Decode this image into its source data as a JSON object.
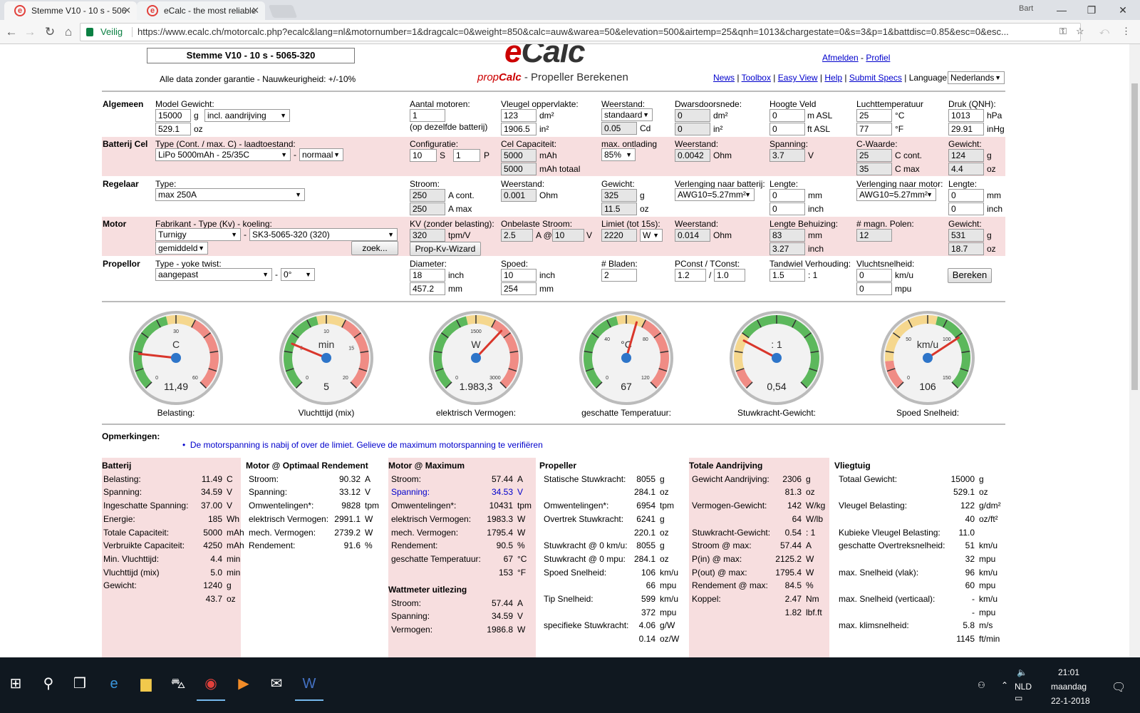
{
  "browser": {
    "tabs": [
      {
        "title": "Stemme V10 - 10 s - 506"
      },
      {
        "title": "eCalc - the most reliable"
      }
    ],
    "user": "Bart",
    "secure_label": "Veilig",
    "url": "https://www.ecalc.ch/motorcalc.php?ecalc&lang=nl&motornumber=1&dragcalc=0&weight=850&calc=auw&warea=50&elevation=500&airtemp=25&qnh=1013&chargestate=0&s=3&p=1&battdisc=0.85&esc=0&esc..."
  },
  "header": {
    "model_title": "Stemme V10 - 10 s - 5065-320",
    "disclaimer": "Alle data zonder garantie - Nauwkeurigheid: +/-10%",
    "logo_e": "e",
    "logo_calc": "Calc",
    "subtitle_prop": "prop",
    "subtitle_calc": "Calc",
    "subtitle_rest": " - Propeller Berekenen",
    "logout": "Afmelden",
    "dash": " - ",
    "profile": "Profiel",
    "nav": [
      "News",
      "Toolbox",
      "Easy View",
      "Help",
      "Submit Specs"
    ],
    "language_label": "Language:",
    "language": "Nederlands"
  },
  "algemeen": {
    "label": "Algemeen",
    "model_weight_label": "Model Gewicht:",
    "weight_g": "15000",
    "unit_g": "g",
    "drive": "incl. aandrijving",
    "weight_oz": "529.1",
    "unit_oz": "oz",
    "motors_label": "Aantal motoren:",
    "motors": "1",
    "motors_note": "(op dezelfde batterij)",
    "wing_label": "Vleugel oppervlakte:",
    "wing_dm": "123",
    "unit_dm": "dm²",
    "wing_in": "1906.5",
    "unit_in": "in²",
    "drag_label": "Weerstand:",
    "drag": "standaard",
    "cd": "0.05",
    "unit_cd": "Cd",
    "cross_label": "Dwarsdoorsnede:",
    "cross_dm": "0",
    "cross_in": "0",
    "field_label": "Hoogte Veld",
    "field_m": "0",
    "unit_masl": "m ASL",
    "field_ft": "0",
    "unit_ftasl": "ft ASL",
    "temp_label": "Luchttemperatuur",
    "temp_c": "25",
    "unit_c": "°C",
    "temp_f": "77",
    "unit_f": "°F",
    "qnh_label": "Druk (QNH):",
    "qnh_hpa": "1013",
    "unit_hpa": "hPa",
    "qnh_inhg": "29.91",
    "unit_inhg": "inHg"
  },
  "batterij": {
    "label": "Batterij Cel",
    "type_label": "Type (Cont. / max. C) - laadtoestand:",
    "type": "LiPo 5000mAh - 25/35C",
    "state": "normaal",
    "config_label": "Configuratie:",
    "s": "10",
    "unit_s": "S",
    "p": "1",
    "unit_p": "P",
    "cap_label": "Cel Capaciteit:",
    "cap": "5000",
    "unit_mah": "mAh",
    "cap_total": "5000",
    "unit_mah_total": "mAh totaal",
    "disch_label": "max. ontlading",
    "disch": "85%",
    "res_label": "Weerstand:",
    "res": "0.0042",
    "unit_ohm": "Ohm",
    "volt_label": "Spanning:",
    "volt": "3.7",
    "unit_v": "V",
    "c_label": "C-Waarde:",
    "c_cont": "25",
    "unit_ccont": "C cont.",
    "c_max": "35",
    "unit_cmax": "C max",
    "w_label": "Gewicht:",
    "w_g": "124",
    "w_oz": "4.4"
  },
  "regelaar": {
    "label": "Regelaar",
    "type_label": "Type:",
    "type": "max 250A",
    "cur_label": "Stroom:",
    "cur_cont": "250",
    "unit_acont": "A cont.",
    "cur_max": "250",
    "unit_amax": "A max",
    "res_label": "Weerstand:",
    "res": "0.001",
    "unit_ohm": "Ohm",
    "w_label": "Gewicht:",
    "w_g": "325",
    "w_oz": "11.5",
    "ext_bat_label": "Verlenging naar batterij:",
    "ext_bat": "AWG10=5.27mm²",
    "len_label": "Lengte:",
    "len_mm": "0",
    "unit_mm": "mm",
    "len_in": "0",
    "unit_inch": "inch",
    "ext_mot_label": "Verlenging naar motor:",
    "ext_mot": "AWG10=5.27mm²",
    "len2_mm": "0",
    "len2_in": "0"
  },
  "motor": {
    "label": "Motor",
    "type_label": "Fabrikant - Type (Kv) - koeling:",
    "maker": "Turnigy",
    "type": "SK3-5065-320 (320)",
    "cooling": "gemiddeld",
    "search": "zoek...",
    "kv_label": "KV (zonder belasting):",
    "kv": "320",
    "unit_kv": "tpm/V",
    "wizard": "Prop-Kv-Wizard",
    "idle_label": "Onbelaste Stroom:",
    "idle_a": "2.5",
    "at": "A @",
    "idle_v": "10",
    "unit_v": "V",
    "limit_label": "Limiet (tot 15s):",
    "limit": "2220",
    "limit_unit": "W",
    "res_label": "Weerstand:",
    "res": "0.014",
    "unit_ohm": "Ohm",
    "case_label": "Lengte Behuizing:",
    "case_mm": "83",
    "case_in": "3.27",
    "poles_label": "# magn. Polen:",
    "poles": "12",
    "w_label": "Gewicht:",
    "w_g": "531",
    "w_oz": "18.7"
  },
  "propellor": {
    "label": "Propellor",
    "type_label": "Type - yoke twist:",
    "type": "aangepast",
    "twist": "0°",
    "dia_label": "Diameter:",
    "dia_in": "18",
    "dia_mm": "457.2",
    "pitch_label": "Spoed:",
    "pitch_in": "10",
    "pitch_mm": "254",
    "blades_label": "# Bladen:",
    "blades": "2",
    "pconst_label": "PConst / TConst:",
    "pconst": "1.2",
    "slash": "/",
    "tconst": "1.0",
    "gear_label": "Tandwiel Verhouding:",
    "gear": "1.5",
    "gear_unit": ": 1",
    "speed_label": "Vluchtsnelheid:",
    "speed_kmh": "0",
    "unit_kmh": "km/u",
    "speed_mph": "0",
    "unit_mph": "mpu",
    "calc_btn": "Bereken"
  },
  "gauges": [
    {
      "unit": "C",
      "value": "11,49",
      "label": "Belasting:",
      "ticks": [
        "0",
        "30",
        "60"
      ],
      "needle": 0.19
    },
    {
      "unit": "min",
      "value": "5",
      "label": "Vluchttijd (mix)",
      "ticks": [
        "0",
        "5",
        "10",
        "15",
        "20"
      ],
      "needle": 0.25
    },
    {
      "unit": "W",
      "value": "1.983,3",
      "label": "elektrisch Vermogen:",
      "ticks": [
        "0",
        "1500",
        "3000"
      ],
      "needle": 0.66
    },
    {
      "unit": "°C",
      "value": "67",
      "label": "geschatte Temperatuur:",
      "ticks": [
        "0",
        "40",
        "80",
        "120"
      ],
      "needle": 0.56
    },
    {
      "unit": ": 1",
      "value": "0,54",
      "label": "Stuwkracht-Gewicht:",
      "ticks": [],
      "needle": 0.27
    },
    {
      "unit": "km/u",
      "value": "106",
      "label": "Spoed Snelheid:",
      "ticks": [
        "0",
        "50",
        "100",
        "150"
      ],
      "needle": 0.71
    }
  ],
  "remarks": {
    "title": "Opmerkingen:",
    "items": [
      "De motorspanning is nabij of over de limiet. Gelieve de maximum motorspanning te verifiëren"
    ]
  },
  "results": {
    "batterij": {
      "title": "Batterij",
      "rows": [
        [
          "Belasting:",
          "11.49",
          "C"
        ],
        [
          "Spanning:",
          "34.59",
          "V"
        ],
        [
          "Ingeschatte Spanning:",
          "37.00",
          "V"
        ],
        [
          "Energie:",
          "185",
          "Wh"
        ],
        [
          "Totale Capaciteit:",
          "5000",
          "mAh"
        ],
        [
          "Verbruikte Capaciteit:",
          "4250",
          "mAh"
        ],
        [
          "Min. Vluchttijd:",
          "4.4",
          "min"
        ],
        [
          "Vluchttijd (mix)",
          "5.0",
          "min"
        ],
        [
          "Gewicht:",
          "1240",
          "g"
        ],
        [
          "",
          "43.7",
          "oz"
        ]
      ]
    },
    "optimaal": {
      "title": "Motor @ Optimaal Rendement",
      "rows": [
        [
          "Stroom:",
          "90.32",
          "A"
        ],
        [
          "Spanning:",
          "33.12",
          "V"
        ],
        [
          "Omwentelingen*:",
          "9828",
          "tpm"
        ],
        [
          "elektrisch Vermogen:",
          "2991.1",
          "W"
        ],
        [
          "mech. Vermogen:",
          "2739.2",
          "W"
        ],
        [
          "Rendement:",
          "91.6",
          "%"
        ]
      ]
    },
    "maximum": {
      "title": "Motor @ Maximum",
      "rows": [
        [
          "Stroom:",
          "57.44",
          "A"
        ],
        [
          "Spanning:",
          "34.53",
          "V"
        ],
        [
          "Omwentelingen*:",
          "10431",
          "tpm"
        ],
        [
          "elektrisch Vermogen:",
          "1983.3",
          "W"
        ],
        [
          "mech. Vermogen:",
          "1795.4",
          "W"
        ],
        [
          "Rendement:",
          "90.5",
          "%"
        ],
        [
          "geschatte Temperatuur:",
          "67",
          "°C"
        ],
        [
          "",
          "153",
          "°F"
        ]
      ]
    },
    "wattmeter": {
      "title": "Wattmeter uitlezing",
      "rows": [
        [
          "Stroom:",
          "57.44",
          "A"
        ],
        [
          "Spanning:",
          "34.59",
          "V"
        ],
        [
          "Vermogen:",
          "1986.8",
          "W"
        ]
      ]
    },
    "propeller": {
      "title": "Propeller",
      "rows": [
        [
          "Statische Stuwkracht:",
          "8055",
          "g"
        ],
        [
          "",
          "284.1",
          "oz"
        ],
        [
          "Omwentelingen*:",
          "6954",
          "tpm"
        ],
        [
          "Overtrek Stuwkracht:",
          "6241",
          "g"
        ],
        [
          "",
          "220.1",
          "oz"
        ],
        [
          "Stuwkracht @ 0 km/u:",
          "8055",
          "g"
        ],
        [
          "Stuwkracht @ 0 mpu:",
          "284.1",
          "oz"
        ],
        [
          "Spoed Snelheid:",
          "106",
          "km/u"
        ],
        [
          "",
          "66",
          "mpu"
        ],
        [
          "Tip Snelheid:",
          "599",
          "km/u"
        ],
        [
          "",
          "372",
          "mpu"
        ],
        [
          "specifieke Stuwkracht:",
          "4.06",
          "g/W"
        ],
        [
          "",
          "0.14",
          "oz/W"
        ]
      ]
    },
    "aandrijving": {
      "title": "Totale Aandrijving",
      "rows": [
        [
          "Gewicht Aandrijving:",
          "2306",
          "g"
        ],
        [
          "",
          "81.3",
          "oz"
        ],
        [
          "Vermogen-Gewicht:",
          "142",
          "W/kg"
        ],
        [
          "",
          "64",
          "W/lb"
        ],
        [
          "Stuwkracht-Gewicht:",
          "0.54",
          "1"
        ],
        [
          "Stroom @ max:",
          "57.44",
          "A"
        ],
        [
          "P(in) @ max:",
          "2125.2",
          "W"
        ],
        [
          "P(out) @ max:",
          "1795.4",
          "W"
        ],
        [
          "Rendement @ max:",
          "84.5",
          "%"
        ],
        [
          "Koppel:",
          "2.47",
          "Nm"
        ],
        [
          "",
          "1.82",
          "lbf.ft"
        ]
      ]
    },
    "vliegtuig": {
      "title": "Vliegtuig",
      "rows": [
        [
          "Totaal Gewicht:",
          "15000",
          "g"
        ],
        [
          "",
          "529.1",
          "oz"
        ],
        [
          "Vleugel Belasting:",
          "122",
          "g/dm²"
        ],
        [
          "",
          "40",
          "oz/ft²"
        ],
        [
          "Kubieke Vleugel Belasting:",
          "11.0",
          ""
        ],
        [
          "geschatte Overtreksnelheid:",
          "51",
          "km/u"
        ],
        [
          "",
          "32",
          "mpu"
        ],
        [
          "max. Snelheid (vlak):",
          "96",
          "km/u"
        ],
        [
          "",
          "60",
          "mpu"
        ],
        [
          "max. Snelheid (verticaal):",
          "-",
          "km/u"
        ],
        [
          "",
          "-",
          "mpu"
        ],
        [
          "max. klimsnelheid:",
          "5.8",
          "m/s"
        ],
        [
          "",
          "1145",
          "ft/min"
        ]
      ]
    }
  },
  "taskbar": {
    "lang": "NLD",
    "time": "21:01",
    "day": "maandag",
    "date": "22-1-2018"
  },
  "colors": {
    "band": "#f7dedf",
    "link": "#0000cc",
    "gauge_green": "#5cb85c",
    "gauge_yellow": "#f5d78e",
    "gauge_red": "#f08c85"
  }
}
